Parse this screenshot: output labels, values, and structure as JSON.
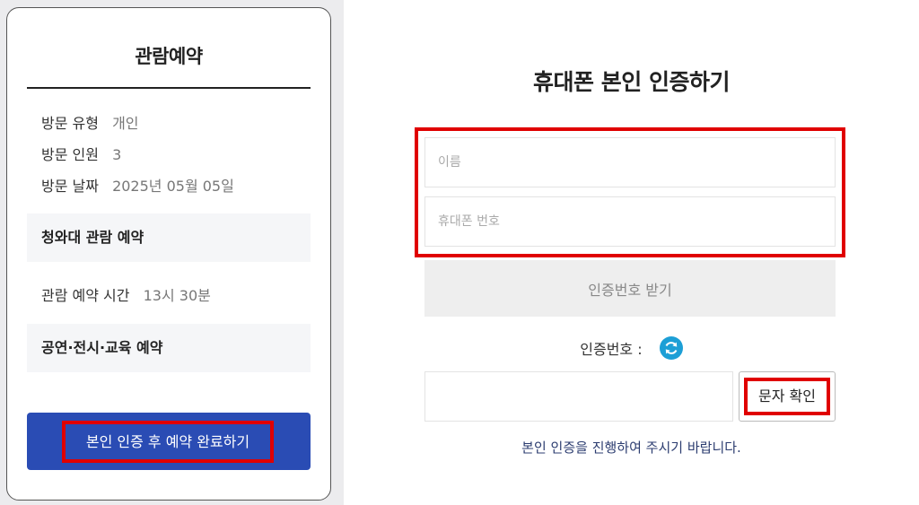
{
  "reservation": {
    "title": "관람예약",
    "visit_type_label": "방문 유형",
    "visit_type_value": "개인",
    "visit_count_label": "방문 인원",
    "visit_count_value": "3",
    "visit_date_label": "방문 날짜",
    "visit_date_value": "2025년 05월 05일",
    "section_tour": "청와대 관람 예약",
    "tour_time_label": "관람 예약 시간",
    "tour_time_value": "13시 30분",
    "section_events": "공연·전시·교육 예약",
    "complete_button": "본인 인증 후 예약 완료하기"
  },
  "verify": {
    "title": "휴대폰 본인 인증하기",
    "name_placeholder": "이름",
    "phone_placeholder": "휴대폰 번호",
    "get_code_button": "인증번호 받기",
    "code_label": "인증번호 :",
    "sms_confirm_button": "문자 확인",
    "notice": "본인 인증을 진행하여 주시기 바랍니다."
  },
  "colors": {
    "primary_button": "#2a4cb4",
    "highlight": "#e00000",
    "refresh_icon": "#1d9fd6",
    "notice_text": "#2c3d70"
  },
  "icons": {
    "refresh": "refresh-icon"
  }
}
